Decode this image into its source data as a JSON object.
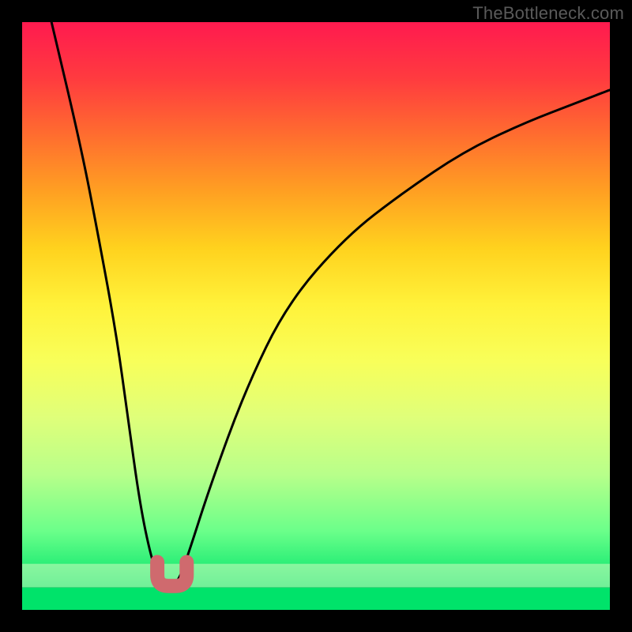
{
  "watermark": {
    "text": "TheBottleneck.com"
  },
  "colors": {
    "black": "#000000",
    "curve": "#000000",
    "marker": "#cf6a6e",
    "green": "#00e36a",
    "gradient": [
      "#ff1a4f",
      "#ff3b3f",
      "#ff6d2f",
      "#ffa022",
      "#ffd21e",
      "#fff23a",
      "#f8ff5a",
      "#dfff7a",
      "#b8ff8a",
      "#6bff8a",
      "#00e36a"
    ]
  },
  "chart_data": {
    "type": "line",
    "title": "",
    "xlabel": "",
    "ylabel": "",
    "xlim": [
      0,
      100
    ],
    "ylim": [
      0,
      100
    ],
    "grid": false,
    "legend": false,
    "x": [
      5,
      10,
      13,
      16,
      18,
      20,
      22,
      23.5,
      25,
      26.5,
      28,
      32,
      38,
      45,
      55,
      65,
      75,
      85,
      95,
      100
    ],
    "values": [
      100,
      78,
      62,
      45,
      30,
      15,
      5,
      1,
      0,
      1,
      5,
      18,
      35,
      50,
      62,
      70,
      77,
      82,
      86,
      88
    ],
    "minimum_x": 25,
    "marker_x_range": [
      23,
      28
    ],
    "green_band_y": 3
  }
}
